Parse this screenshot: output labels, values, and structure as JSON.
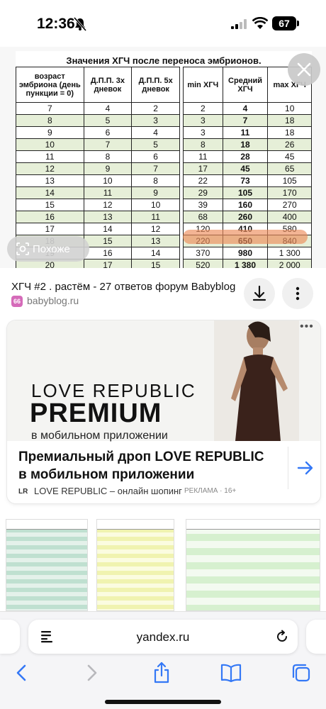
{
  "status_bar": {
    "time": "12:36",
    "battery": "67"
  },
  "sheet": {
    "title": "Значения ХГЧ после переноса эмбрионов.",
    "left_headers": [
      "возраст эмбриона (день пункции = 0)",
      "Д.П.П. 3х дневок",
      "Д.П.П. 5х дневок"
    ],
    "right_headers": [
      "min ХГЧ",
      "Средний ХГЧ",
      "max ХГЧ"
    ],
    "rows": [
      [
        "7",
        "4",
        "2",
        "2",
        "4",
        "10"
      ],
      [
        "8",
        "5",
        "3",
        "3",
        "7",
        "18"
      ],
      [
        "9",
        "6",
        "4",
        "3",
        "11",
        "18"
      ],
      [
        "10",
        "7",
        "5",
        "8",
        "18",
        "26"
      ],
      [
        "11",
        "8",
        "6",
        "11",
        "28",
        "45"
      ],
      [
        "12",
        "9",
        "7",
        "17",
        "45",
        "65"
      ],
      [
        "13",
        "10",
        "8",
        "22",
        "73",
        "105"
      ],
      [
        "14",
        "11",
        "9",
        "29",
        "105",
        "170"
      ],
      [
        "15",
        "12",
        "10",
        "39",
        "160",
        "270"
      ],
      [
        "16",
        "13",
        "11",
        "68",
        "260",
        "400"
      ],
      [
        "17",
        "14",
        "12",
        "120",
        "410",
        "580"
      ],
      [
        "18",
        "15",
        "13",
        "220",
        "650",
        "840"
      ],
      [
        "19",
        "16",
        "14",
        "370",
        "980",
        "1 300"
      ],
      [
        "20",
        "17",
        "15",
        "520",
        "1 380",
        "2 000"
      ]
    ]
  },
  "similar_button": {
    "label": "Похоже"
  },
  "result": {
    "title": "ХГЧ #2 . растём - 27 ответов форум Babyblog",
    "favicon_text": "66",
    "domain": "babyblog.ru"
  },
  "ad": {
    "brand_line1": "LOVE REPUBLIC",
    "brand_line2": "PREMIUM",
    "brand_line3": "в мобильном приложении",
    "dots": "•••",
    "headline": "Премиальный дроп LOVE REPUBLIC в мобильном приложении",
    "logo_text": "LR",
    "source": "LOVE REPUBLIC – онлайн шопинг",
    "label": "РЕКЛАМА · 16+"
  },
  "browser": {
    "url": "yandex.ru"
  },
  "colors": {
    "accent": "#3478f6",
    "highlight": "#ec8c5a",
    "row_green": "#e6efd8"
  }
}
